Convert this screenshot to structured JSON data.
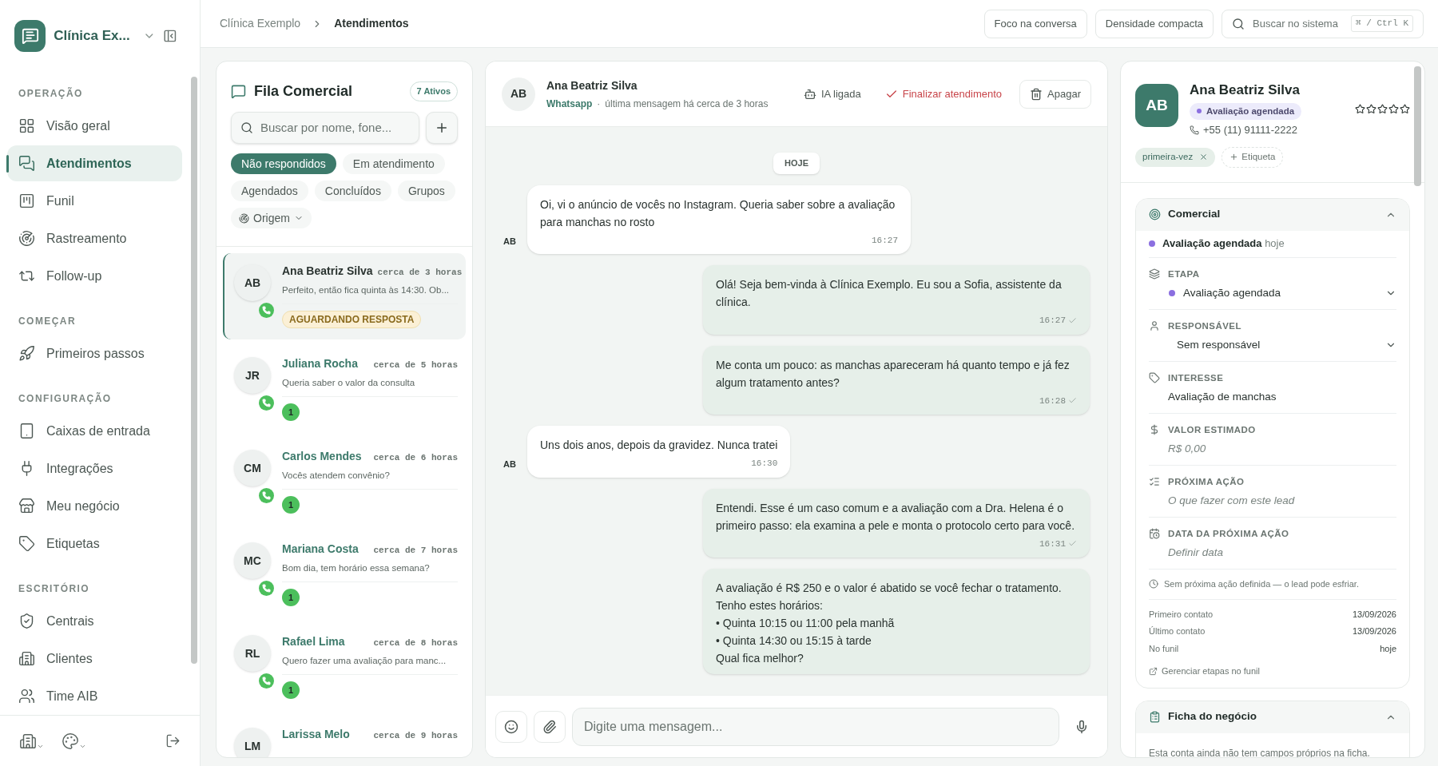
{
  "sidebar": {
    "workspace": "Clínica Ex...",
    "sections": [
      {
        "title": "OPERAÇÃO",
        "items": [
          {
            "label": "Visão geral",
            "selected": false
          },
          {
            "label": "Atendimentos",
            "selected": true
          },
          {
            "label": "Funil",
            "selected": false
          },
          {
            "label": "Rastreamento",
            "selected": false
          },
          {
            "label": "Follow-up",
            "selected": false
          }
        ]
      },
      {
        "title": "COMEÇAR",
        "items": [
          {
            "label": "Primeiros passos",
            "selected": false
          }
        ]
      },
      {
        "title": "CONFIGURAÇÃO",
        "items": [
          {
            "label": "Caixas de entrada",
            "selected": false
          },
          {
            "label": "Integrações",
            "selected": false
          },
          {
            "label": "Meu negócio",
            "selected": false
          },
          {
            "label": "Etiquetas",
            "selected": false
          }
        ]
      },
      {
        "title": "ESCRITÓRIO",
        "items": [
          {
            "label": "Centrais",
            "selected": false
          },
          {
            "label": "Clientes",
            "selected": false
          },
          {
            "label": "Time AIB",
            "selected": false
          }
        ]
      }
    ]
  },
  "breadcrumb": [
    "Clínica Exemplo",
    "Atendimentos"
  ],
  "top_actions": [
    "Foco na conversa",
    "Densidade compacta"
  ],
  "global_search": {
    "placeholder": "Buscar no sistema",
    "shortcut": "⌘ / Ctrl K"
  },
  "queue": {
    "title": "Fila Comercial",
    "count": "7 Ativos",
    "search": {
      "placeholder": "Buscar por nome, fone..."
    },
    "filters": [
      {
        "label": "Não respondidos",
        "selected": true
      },
      {
        "label": "Em atendimento",
        "selected": false
      },
      {
        "label": "Agendados",
        "selected": false
      },
      {
        "label": "Concluídos",
        "selected": false
      },
      {
        "label": "Grupos",
        "selected": false
      }
    ],
    "origin": "Origem",
    "conversations": [
      {
        "initials": "AB",
        "name": "Ana Beatriz Silva",
        "time": "cerca de 3 horas",
        "preview": "Perfeito, então fica quinta às 14:30. Ob...",
        "status": "AGUARDANDO RESPOSTA",
        "selected": true
      },
      {
        "initials": "JR",
        "name": "Juliana Rocha",
        "time": "cerca de 5 horas",
        "preview": "Queria saber o valor da consulta",
        "unread": "1",
        "selected": false
      },
      {
        "initials": "CM",
        "name": "Carlos Mendes",
        "time": "cerca de 6 horas",
        "preview": "Vocês atendem convênio?",
        "unread": "1",
        "selected": false
      },
      {
        "initials": "MC",
        "name": "Mariana Costa",
        "time": "cerca de 7 horas",
        "preview": "Bom dia, tem horário essa semana?",
        "unread": "1",
        "selected": false
      },
      {
        "initials": "RL",
        "name": "Rafael Lima",
        "time": "cerca de 8 horas",
        "preview": "Quero fazer uma avaliação para manc...",
        "unread": "1",
        "selected": false
      },
      {
        "initials": "LM",
        "name": "Larissa Melo",
        "time": "cerca de 9 horas",
        "selected": false
      }
    ]
  },
  "chat": {
    "initials": "AB",
    "name": "Ana Beatriz Silva",
    "channel": "Whatsapp",
    "separator": "·",
    "last_message": "última mensagem há cerca de 3 horas",
    "ai": "IA ligada",
    "finish": "Finalizar atendimento",
    "delete": "Apagar",
    "day": "HOJE",
    "messages": [
      {
        "kind": "incoming",
        "initials": "AB",
        "text": "Oi, vi o anúncio de vocês no Instagram. Queria saber sobre a avaliação para manchas no rosto",
        "time": "16:27"
      },
      {
        "kind": "outgoing",
        "text": "Olá! Seja bem-vinda à Clínica Exemplo. Eu sou a Sofia, assistente da clínica.",
        "time": "16:27",
        "delivered": true
      },
      {
        "kind": "outgoing",
        "text": "Me conta um pouco: as manchas apareceram há quanto tempo e já fez algum tratamento antes?",
        "time": "16:28",
        "delivered": true
      },
      {
        "kind": "incoming",
        "initials": "AB",
        "text": "Uns dois anos, depois da gravidez. Nunca tratei",
        "time": "16:30"
      },
      {
        "kind": "outgoing",
        "text": "Entendi. Esse é um caso comum e a avaliação com a Dra. Helena é o primeiro passo: ela examina a pele e monta o protocolo certo para você.",
        "time": "16:31",
        "delivered": true
      },
      {
        "kind": "outgoing",
        "text": "A avaliação é R$ 250 e o valor é abatido se você fechar o tratamento.\nTenho estes horários:\n• Quinta 10:15 ou 11:00 pela manhã\n• Quinta 14:30 ou 15:15 à tarde\nQual fica melhor?"
      }
    ],
    "composer": {
      "placeholder": "Digite uma mensagem..."
    }
  },
  "contact": {
    "initials": "AB",
    "name": "Ana Beatriz Silva",
    "stage": "Avaliação agendada",
    "color": "#8b6fe0",
    "phone": "+55 (11) 91111-2222",
    "stars": 0,
    "tags": [
      "primeira-vez"
    ],
    "add_tag": "Etiqueta"
  },
  "commercial": {
    "title": "Comercial",
    "expanded": true,
    "summary": {
      "stage": "Avaliação agendada",
      "when": "hoje",
      "color": "#8b6fe0"
    },
    "fields": [
      {
        "kind": "select",
        "label": "ETAPA",
        "value": "Avaliação agendada",
        "color": "#8b6fe0"
      },
      {
        "kind": "select",
        "label": "RESPONSÁVEL",
        "value": "Sem responsável"
      },
      {
        "kind": "text",
        "label": "INTERESSE",
        "value": "Avaliação de manchas"
      },
      {
        "kind": "placeholder",
        "label": "VALOR ESTIMADO",
        "placeholder": "R$ 0,00"
      },
      {
        "kind": "placeholder",
        "label": "PRÓXIMA AÇÃO",
        "placeholder": "O que fazer com este lead"
      },
      {
        "kind": "placeholder",
        "label": "DATA DA PRÓXIMA AÇÃO",
        "placeholder": "Definir data"
      }
    ],
    "warning": "Sem próxima ação definida — o lead pode esfriar.",
    "dates": [
      {
        "label": "Primeiro contato",
        "value": "13/09/2026"
      },
      {
        "label": "Último contato",
        "value": "13/09/2026"
      },
      {
        "label": "No funil",
        "value": "hoje"
      }
    ],
    "link": "Gerenciar etapas no funil"
  },
  "business": {
    "title": "Ficha do negócio",
    "expanded": true,
    "text": "Esta conta ainda não tem campos próprios na ficha."
  }
}
